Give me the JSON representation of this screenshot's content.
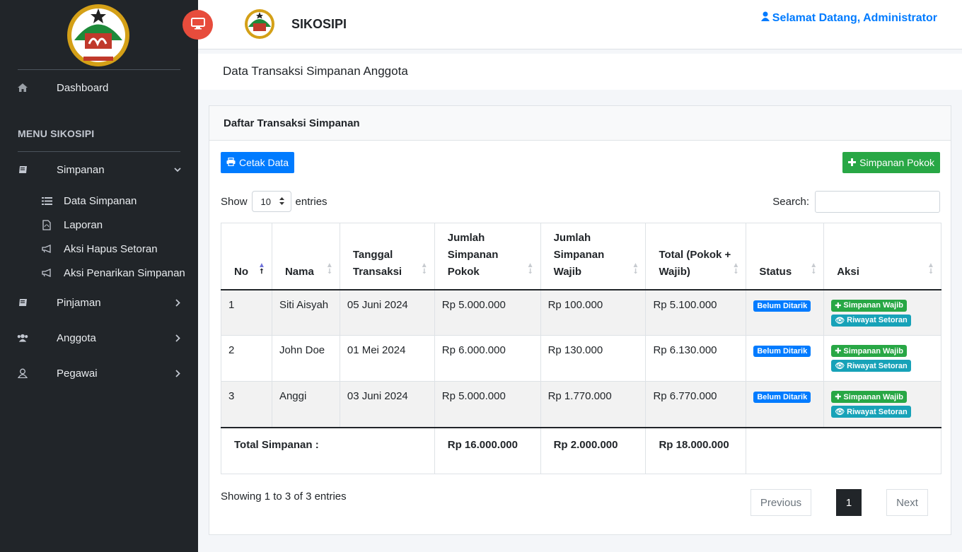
{
  "app": {
    "name": "SIKOSIPI",
    "welcome": "Selamat Datang, Administrator"
  },
  "sidebar": {
    "dashboard": "Dashboard",
    "menu_header": "MENU SIKOSIPI",
    "simpanan": "Simpanan",
    "sub": [
      "Data Simpanan",
      "Laporan",
      "Aksi Hapus Setoran",
      "Aksi Penarikan Simpanan"
    ],
    "pinjaman": "Pinjaman",
    "anggota": "Anggota",
    "pegawai": "Pegawai"
  },
  "page": {
    "title": "Data Transaksi Simpanan Anggota"
  },
  "card": {
    "title": "Daftar Transaksi Simpanan",
    "print_button": "Cetak Data",
    "add_button": "Simpanan Pokok",
    "show_label": "Show",
    "entries_value": "10",
    "entries_label": "entries",
    "search_label": "Search:"
  },
  "table": {
    "headers": [
      "No",
      "Nama",
      "Tanggal Transaksi",
      "Jumlah Simpanan Pokok",
      "Jumlah Simpanan Wajib",
      "Total (Pokok + Wajib)",
      "Status",
      "Aksi"
    ],
    "rows": [
      {
        "no": "1",
        "nama": "Siti Aisyah",
        "tanggal": "05 Juni 2024",
        "pokok": "Rp 5.000.000",
        "wajib": "Rp 100.000",
        "total": "Rp 5.100.000",
        "status": "Belum Ditarik"
      },
      {
        "no": "2",
        "nama": "John Doe",
        "tanggal": "01 Mei 2024",
        "pokok": "Rp 6.000.000",
        "wajib": "Rp 130.000",
        "total": "Rp 6.130.000",
        "status": "Belum Ditarik"
      },
      {
        "no": "3",
        "nama": "Anggi",
        "tanggal": "03 Juni 2024",
        "pokok": "Rp 5.000.000",
        "wajib": "Rp 1.770.000",
        "total": "Rp 6.770.000",
        "status": "Belum Ditarik"
      }
    ],
    "action_wajib": "Simpanan Wajib",
    "action_riwayat": "Riwayat Setoran",
    "footer": {
      "label": "Total Simpanan :",
      "pokok": "Rp 16.000.000",
      "wajib": "Rp 2.000.000",
      "total": "Rp 18.000.000"
    }
  },
  "pagination": {
    "info": "Showing 1 to 3 of 3 entries",
    "previous": "Previous",
    "page": "1",
    "next": "Next"
  },
  "colors": {
    "sidebar_bg": "#212529",
    "primary": "#007bff",
    "success": "#28a745",
    "info": "#17a2b8",
    "toggle": "#e74c3c"
  }
}
